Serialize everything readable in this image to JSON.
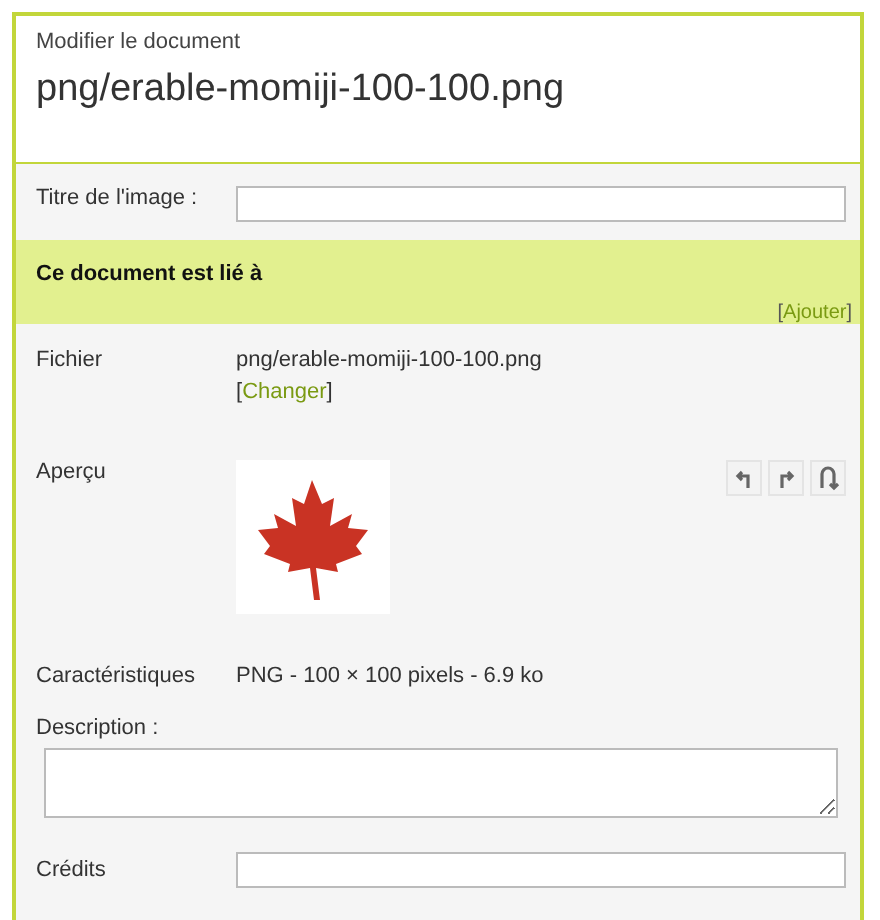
{
  "header": {
    "subtitle": "Modifier le document",
    "title": "png/erable-momiji-100-100.png"
  },
  "title_field": {
    "label": "Titre de l'image :"
  },
  "links_band": {
    "title": "Ce document est lié à",
    "action_open": "[",
    "action": "Ajouter",
    "action_close": "]"
  },
  "file": {
    "label": "Fichier",
    "value": "png/erable-momiji-100-100.png",
    "change_open": "[",
    "change": "Changer",
    "change_close": "]"
  },
  "preview": {
    "label": "Aperçu",
    "tools": [
      {
        "kind": "rotate-left"
      },
      {
        "kind": "rotate-right"
      },
      {
        "kind": "flip"
      }
    ]
  },
  "specs": {
    "label": "Caractéristiques",
    "value": "PNG - 100 × 100 pixels - 6.9 ko"
  },
  "description": {
    "label": "Description :"
  },
  "credits": {
    "label": "Crédits"
  }
}
